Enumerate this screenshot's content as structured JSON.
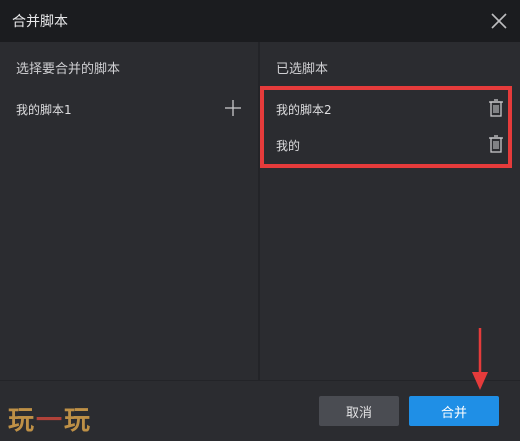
{
  "dialog": {
    "title": "合并脚本"
  },
  "left_panel": {
    "header": "选择要合并的脚本",
    "items": [
      {
        "label": "我的脚本1"
      }
    ]
  },
  "right_panel": {
    "header": "已选脚本",
    "items": [
      {
        "label": "我的脚本2"
      },
      {
        "label": "我的"
      }
    ]
  },
  "footer": {
    "cancel_label": "取消",
    "merge_label": "合并"
  },
  "watermark": {
    "part1": "玩",
    "part2": "一",
    "part3": "玩"
  },
  "colors": {
    "highlight": "#e53b3b",
    "primary_button": "#1f8fe6",
    "titlebar": "#1b1c1f",
    "background": "#2b2c30"
  }
}
